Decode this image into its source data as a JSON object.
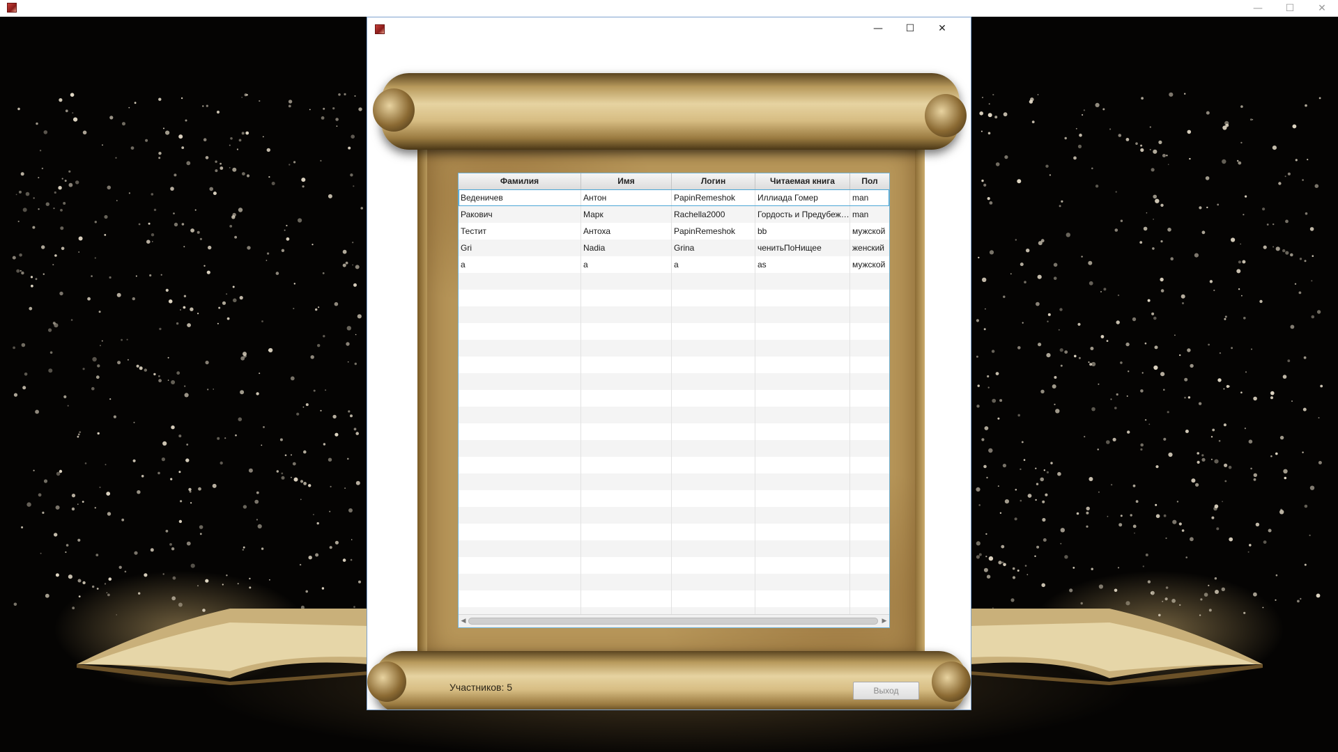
{
  "outer_window": {
    "controls": {
      "minimize": "—",
      "maximize": "☐",
      "close": "✕"
    }
  },
  "dialog": {
    "controls": {
      "minimize": "—",
      "maximize": "☐",
      "close": "✕"
    }
  },
  "table": {
    "columns": [
      "Фамилия",
      "Имя",
      "Логин",
      "Читаемая книга",
      "Пол"
    ],
    "rows": [
      [
        "Веденичев",
        "Антон",
        "PapinRemeshok",
        "Иллиада Гомер",
        "man"
      ],
      [
        "Ракович",
        "Марк",
        "Rachella2000",
        "Гордость и Предубеждение",
        "man"
      ],
      [
        "Тестит",
        "Антоха",
        "PapinRemeshok",
        "bb",
        "мужской"
      ],
      [
        "Gri",
        "Nadia",
        "Grina",
        "ченитьПоНищее",
        "женский"
      ],
      [
        "a",
        "a",
        "a",
        "as",
        "мужской"
      ]
    ],
    "selected_row": 0,
    "scroll_left": "◀",
    "scroll_right": "▶"
  },
  "footer": {
    "participants_label": "Участников: 5",
    "exit_label": "Выход"
  },
  "colors": {
    "table_border": "#6fb3d9",
    "parchment": "#e6d3a1"
  }
}
